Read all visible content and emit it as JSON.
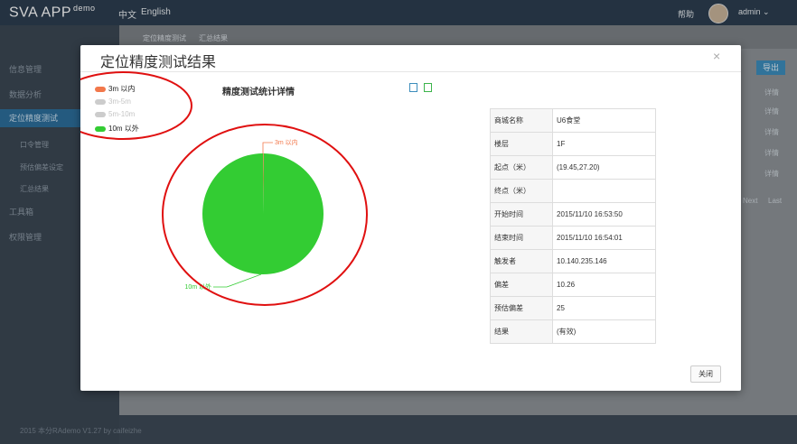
{
  "app": {
    "brand": "SVA APP",
    "brand_sup": "demo",
    "lang_zh": "中文",
    "lang_en": "English",
    "help": "帮助",
    "user": "admin"
  },
  "sidebar": {
    "items": [
      "信息管理",
      "数据分析",
      "定位精度测试",
      "工具箱",
      "权限管理"
    ],
    "subitems": [
      "口令管理",
      "预估偏差设定",
      "汇总结果"
    ]
  },
  "breadcrumb": {
    "first": "定位精度测试",
    "second": "汇总结果"
  },
  "background": {
    "export_label": "导出",
    "col_detail": "详情",
    "row_detail": "详情",
    "pager": [
      "Next",
      "Last"
    ]
  },
  "footer": {
    "text": "2015 本分RAdemo V1.27 by caifeizhe"
  },
  "modal": {
    "title": "定位精度测试结果",
    "close_icon": "×",
    "close_button": "关闭",
    "chart_title": "精度测试统计详情",
    "table": [
      {
        "key": "商城名称",
        "value": "U6食堂"
      },
      {
        "key": "楼层",
        "value": "1F"
      },
      {
        "key": "起点（米）",
        "value": "(19.45,27.20)"
      },
      {
        "key": "终点（米）",
        "value": ""
      },
      {
        "key": "开始时间",
        "value": "2015/11/10 16:53:50"
      },
      {
        "key": "结束时间",
        "value": "2015/11/10 16:54:01"
      },
      {
        "key": "触发者",
        "value": "10.140.235.146"
      },
      {
        "key": "偏差",
        "value": "10.26"
      },
      {
        "key": "预估偏差",
        "value": "25"
      },
      {
        "key": "结果",
        "value": "(有效)"
      }
    ]
  },
  "chart_data": {
    "type": "pie",
    "title": "精度测试统计详情",
    "categories": [
      "3m 以内",
      "3m-5m",
      "5m-10m",
      "10m 以外"
    ],
    "values": [
      0.2,
      0,
      0,
      99.8
    ],
    "colors": [
      "#f2784b",
      "#cccccc",
      "#cccccc",
      "#33cc33"
    ],
    "legend": [
      "3m 以内",
      "3m-5m",
      "5m-10m",
      "10m 以外"
    ],
    "legend_position": "top-left",
    "slice_labels": [
      "3m 以内",
      "10m 以外"
    ]
  },
  "colors": {
    "accent": "#3c8dbc",
    "annotation": "#e01010",
    "green": "#33cc33",
    "orange": "#f2784b"
  }
}
